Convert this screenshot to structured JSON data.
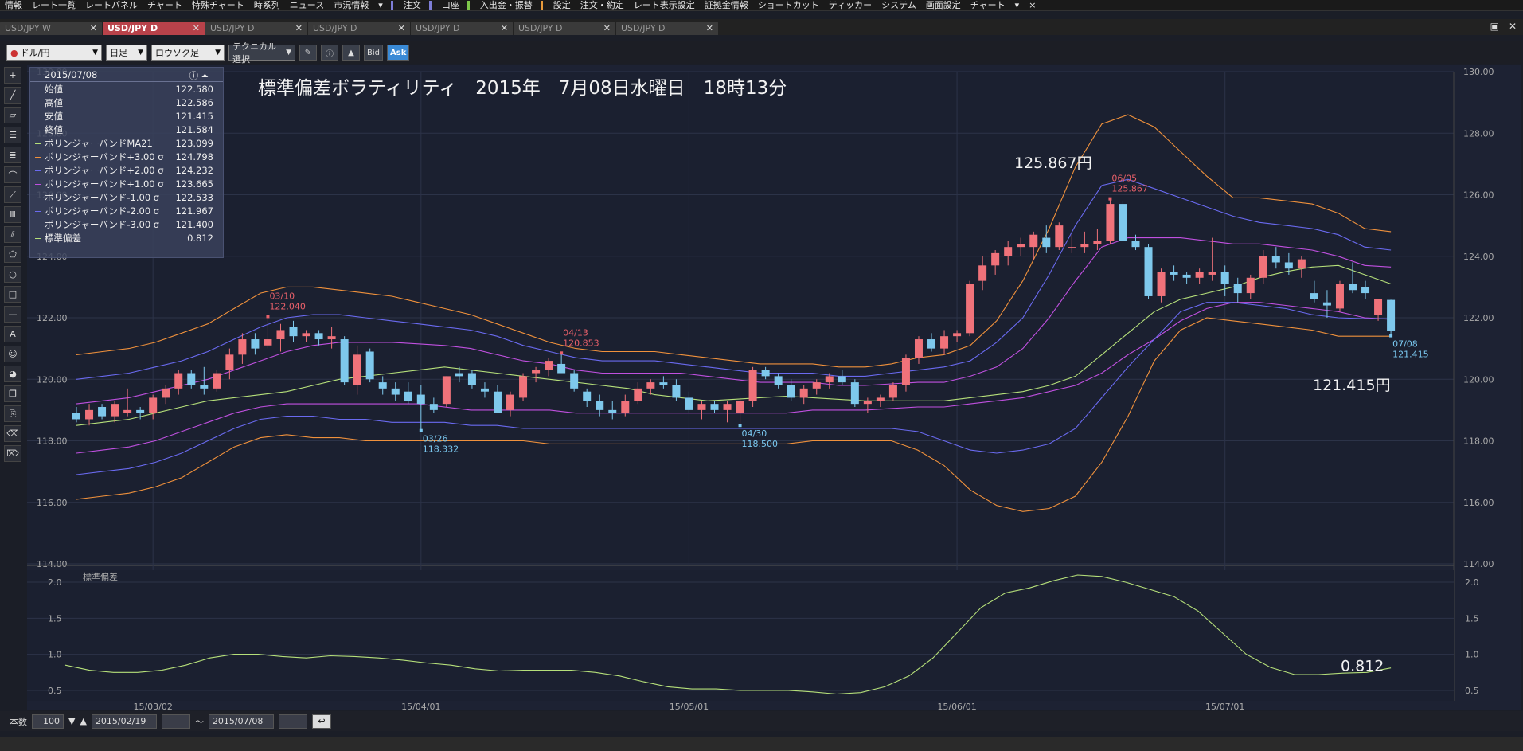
{
  "menubar": {
    "items": [
      "情報",
      "レート一覧",
      "レートパネル",
      "チャート",
      "特殊チャート",
      "時系列",
      "ニュース",
      "市況情報",
      "▾",
      "注文",
      "口座",
      "入出金・振替",
      "設定",
      "注文・約定",
      "レート表示設定",
      "証拠金情報",
      "ショートカット",
      "ティッカー",
      "システム",
      "画面設定",
      "チャート",
      "▾",
      "×"
    ]
  },
  "tabs": [
    {
      "label": "USD/JPY W",
      "active": false
    },
    {
      "label": "USD/JPY D",
      "active": true
    },
    {
      "label": "USD/JPY D",
      "active": false
    },
    {
      "label": "USD/JPY D",
      "active": false
    },
    {
      "label": "USD/JPY D",
      "active": false
    },
    {
      "label": "USD/JPY D",
      "active": false
    },
    {
      "label": "USD/JPY D",
      "active": false
    }
  ],
  "toolbar": {
    "pair": "ドル/円",
    "timeframe": "日足",
    "chart_type": "ロウソク足",
    "technical": "テクニカル選択",
    "bid": "Bid",
    "ask": "Ask"
  },
  "info": {
    "date": "2015/07/08",
    "rows": [
      {
        "label": "始値",
        "value": "122.580",
        "color": ""
      },
      {
        "label": "高値",
        "value": "122.586",
        "color": ""
      },
      {
        "label": "安値",
        "value": "121.415",
        "color": ""
      },
      {
        "label": "終値",
        "value": "121.584",
        "color": ""
      },
      {
        "label": "ボリンジャーバンドMA21",
        "value": "123.099",
        "color": "#b6e07a"
      },
      {
        "label": "ボリンジャーバンド+3.00 σ",
        "value": "124.798",
        "color": "#f0913c"
      },
      {
        "label": "ボリンジャーバンド+2.00 σ",
        "value": "124.232",
        "color": "#6a6af0"
      },
      {
        "label": "ボリンジャーバンド+1.00 σ",
        "value": "123.665",
        "color": "#c050e0"
      },
      {
        "label": "ボリンジャーバンド-1.00 σ",
        "value": "122.533",
        "color": "#c050e0"
      },
      {
        "label": "ボリンジャーバンド-2.00 σ",
        "value": "121.967",
        "color": "#6a6af0"
      },
      {
        "label": "ボリンジャーバンド-3.00 σ",
        "value": "121.400",
        "color": "#f0913c"
      },
      {
        "label": "標準偏差",
        "value": "0.812",
        "color": "#b6e07a"
      }
    ]
  },
  "chart_data": {
    "type": "candlestick",
    "title": "標準偏差ボラティリティ　2015年　7月08日水曜日　18時13分",
    "ylim": [
      114,
      130
    ],
    "yticks": [
      "130.00",
      "128.00",
      "126.00",
      "124.00",
      "122.00",
      "120.00",
      "118.00",
      "116.00",
      "114.00"
    ],
    "xticks": [
      "15/03/02",
      "15/04/01",
      "15/05/01",
      "15/06/01",
      "15/07/01"
    ],
    "candles": [
      [
        118.9,
        119.1,
        118.6,
        118.7
      ],
      [
        118.7,
        119.2,
        118.5,
        119.0
      ],
      [
        119.1,
        119.2,
        118.7,
        118.8
      ],
      [
        118.8,
        119.3,
        118.6,
        119.2
      ],
      [
        118.9,
        119.7,
        118.8,
        119.0
      ],
      [
        119.0,
        119.1,
        118.7,
        118.9
      ],
      [
        118.9,
        119.5,
        118.7,
        119.4
      ],
      [
        119.4,
        119.8,
        119.2,
        119.7
      ],
      [
        119.7,
        120.3,
        119.5,
        120.2
      ],
      [
        120.2,
        120.3,
        119.7,
        119.8
      ],
      [
        119.8,
        120.4,
        119.5,
        119.7
      ],
      [
        119.7,
        120.3,
        119.6,
        120.2
      ],
      [
        120.3,
        121.0,
        120.0,
        120.8
      ],
      [
        120.8,
        121.5,
        120.5,
        121.3
      ],
      [
        121.3,
        121.5,
        120.8,
        121.0
      ],
      [
        121.1,
        122.04,
        121.0,
        121.3
      ],
      [
        121.3,
        121.8,
        120.9,
        121.6
      ],
      [
        121.7,
        121.9,
        121.2,
        121.4
      ],
      [
        121.4,
        121.6,
        121.2,
        121.5
      ],
      [
        121.5,
        121.6,
        121.1,
        121.3
      ],
      [
        121.3,
        121.7,
        121.0,
        121.4
      ],
      [
        121.3,
        121.4,
        119.8,
        119.9
      ],
      [
        119.8,
        121.1,
        119.5,
        120.8
      ],
      [
        120.9,
        121.0,
        119.9,
        120.0
      ],
      [
        119.9,
        120.1,
        119.5,
        119.7
      ],
      [
        119.7,
        119.9,
        119.3,
        119.5
      ],
      [
        119.6,
        119.9,
        119.2,
        119.3
      ],
      [
        119.5,
        119.8,
        118.332,
        119.2
      ],
      [
        119.2,
        119.4,
        118.9,
        119.0
      ],
      [
        119.2,
        120.1,
        119.1,
        120.1
      ],
      [
        120.2,
        120.4,
        119.9,
        120.1
      ],
      [
        120.2,
        120.3,
        119.7,
        119.8
      ],
      [
        119.7,
        119.9,
        119.4,
        119.6
      ],
      [
        119.6,
        119.8,
        119.0,
        118.9
      ],
      [
        119.0,
        119.6,
        118.8,
        119.5
      ],
      [
        119.4,
        120.2,
        119.3,
        120.1
      ],
      [
        120.2,
        120.4,
        119.9,
        120.3
      ],
      [
        120.3,
        120.7,
        120.1,
        120.6
      ],
      [
        120.5,
        120.853,
        120.2,
        120.2
      ],
      [
        120.2,
        120.3,
        119.6,
        119.7
      ],
      [
        119.6,
        119.7,
        119.1,
        119.3
      ],
      [
        119.3,
        119.5,
        118.8,
        119.0
      ],
      [
        119.0,
        119.3,
        118.7,
        118.9
      ],
      [
        118.9,
        119.5,
        118.8,
        119.3
      ],
      [
        119.3,
        119.9,
        119.2,
        119.7
      ],
      [
        119.7,
        120.0,
        119.5,
        119.9
      ],
      [
        119.9,
        120.1,
        119.7,
        119.8
      ],
      [
        119.8,
        120.0,
        119.3,
        119.4
      ],
      [
        119.4,
        119.6,
        118.9,
        119.0
      ],
      [
        119.0,
        119.3,
        118.7,
        119.2
      ],
      [
        119.2,
        119.3,
        118.9,
        119.0
      ],
      [
        119.0,
        119.3,
        118.6,
        119.2
      ],
      [
        118.9,
        119.4,
        118.5,
        119.3
      ],
      [
        119.3,
        120.4,
        119.1,
        120.3
      ],
      [
        120.3,
        120.4,
        120.0,
        120.1
      ],
      [
        120.1,
        120.2,
        119.7,
        119.8
      ],
      [
        119.8,
        120.0,
        119.3,
        119.4
      ],
      [
        119.4,
        119.8,
        119.2,
        119.7
      ],
      [
        119.7,
        120.0,
        119.5,
        119.9
      ],
      [
        119.9,
        120.2,
        119.7,
        120.1
      ],
      [
        120.1,
        120.3,
        119.8,
        119.9
      ],
      [
        119.9,
        120.0,
        119.1,
        119.2
      ],
      [
        119.2,
        119.4,
        118.9,
        119.3
      ],
      [
        119.3,
        119.5,
        119.1,
        119.4
      ],
      [
        119.4,
        119.9,
        119.3,
        119.8
      ],
      [
        119.8,
        120.8,
        119.6,
        120.7
      ],
      [
        120.7,
        121.4,
        120.5,
        121.3
      ],
      [
        121.3,
        121.5,
        120.9,
        121.0
      ],
      [
        121.0,
        121.6,
        120.8,
        121.4
      ],
      [
        121.4,
        121.6,
        121.2,
        121.5
      ],
      [
        121.5,
        123.2,
        121.4,
        123.1
      ],
      [
        123.2,
        124.0,
        122.9,
        123.7
      ],
      [
        123.7,
        124.2,
        123.4,
        124.1
      ],
      [
        124.0,
        124.5,
        123.7,
        124.3
      ],
      [
        124.3,
        124.6,
        124.0,
        124.4
      ],
      [
        124.3,
        124.8,
        123.9,
        124.7
      ],
      [
        124.6,
        125.0,
        124.1,
        124.3
      ],
      [
        124.3,
        125.1,
        124.2,
        125.0
      ],
      [
        124.3,
        124.7,
        124.1,
        124.3
      ],
      [
        124.3,
        124.8,
        124.1,
        124.4
      ],
      [
        124.4,
        124.9,
        124.2,
        124.5
      ],
      [
        124.5,
        125.867,
        124.4,
        125.7
      ],
      [
        125.7,
        125.8,
        124.5,
        124.5
      ],
      [
        124.5,
        124.7,
        124.2,
        124.3
      ],
      [
        124.3,
        124.4,
        122.6,
        122.7
      ],
      [
        122.7,
        123.6,
        122.5,
        123.5
      ],
      [
        123.5,
        123.7,
        123.2,
        123.4
      ],
      [
        123.4,
        123.5,
        123.1,
        123.3
      ],
      [
        123.3,
        123.6,
        123.1,
        123.5
      ],
      [
        123.4,
        124.6,
        123.2,
        123.5
      ],
      [
        123.5,
        123.7,
        122.7,
        123.1
      ],
      [
        123.1,
        123.3,
        122.5,
        122.8
      ],
      [
        122.8,
        123.4,
        122.6,
        123.3
      ],
      [
        123.3,
        124.2,
        123.1,
        124.0
      ],
      [
        124.0,
        124.3,
        123.6,
        123.8
      ],
      [
        123.8,
        124.1,
        123.4,
        123.6
      ],
      [
        123.6,
        124.0,
        123.3,
        123.9
      ],
      [
        122.8,
        123.2,
        122.5,
        122.6
      ],
      [
        122.5,
        122.9,
        122.0,
        122.4
      ],
      [
        122.3,
        123.2,
        122.2,
        123.1
      ],
      [
        123.1,
        123.8,
        122.8,
        122.9
      ],
      [
        123.0,
        123.2,
        122.6,
        122.8
      ],
      [
        122.1,
        122.6,
        121.9,
        122.6
      ],
      [
        122.58,
        122.586,
        121.415,
        121.584
      ]
    ],
    "annotations": [
      {
        "idx": 15,
        "date": "03/10",
        "price": "122.040",
        "side": "high",
        "color": "#e8606a"
      },
      {
        "idx": 27,
        "date": "03/26",
        "price": "118.332",
        "side": "low",
        "color": "#7ac8f0"
      },
      {
        "idx": 38,
        "date": "04/13",
        "price": "120.853",
        "side": "high",
        "color": "#e8606a"
      },
      {
        "idx": 52,
        "date": "04/30",
        "price": "118.500",
        "side": "low",
        "color": "#7ac8f0"
      },
      {
        "idx": 81,
        "date": "06/05",
        "price": "125.867",
        "side": "high",
        "color": "#e8606a"
      },
      {
        "idx": 103,
        "date": "07/08",
        "price": "121.415",
        "side": "low",
        "color": "#7ac8f0"
      }
    ],
    "big_labels": {
      "high": "125.867円",
      "low": "121.415円",
      "stddev": "0.812"
    },
    "bands": {
      "ma21": [
        118.5,
        118.6,
        118.7,
        118.9,
        119.1,
        119.3,
        119.4,
        119.5,
        119.6,
        119.8,
        120.0,
        120.1,
        120.2,
        120.3,
        120.4,
        120.3,
        120.2,
        120.1,
        120.0,
        119.9,
        119.8,
        119.7,
        119.5,
        119.4,
        119.3,
        119.35,
        119.4,
        119.45,
        119.4,
        119.35,
        119.3,
        119.3,
        119.3,
        119.3,
        119.4,
        119.5,
        119.6,
        119.8,
        120.1,
        120.8,
        121.5,
        122.2,
        122.6,
        122.8,
        123.0,
        123.3,
        123.5,
        123.65,
        123.7,
        123.4,
        123.1
      ],
      "p1": [
        119.2,
        119.3,
        119.4,
        119.6,
        119.8,
        120.0,
        120.3,
        120.6,
        120.9,
        121.1,
        121.2,
        121.2,
        121.2,
        121.15,
        121.1,
        121.0,
        120.8,
        120.6,
        120.5,
        120.3,
        120.2,
        120.2,
        120.2,
        120.2,
        120.1,
        120.0,
        119.9,
        119.9,
        119.9,
        119.8,
        119.8,
        119.85,
        119.9,
        119.9,
        120.1,
        120.4,
        121.0,
        122.0,
        123.2,
        124.3,
        124.6,
        124.6,
        124.6,
        124.5,
        124.4,
        124.4,
        124.3,
        124.2,
        124.0,
        123.7,
        123.65
      ],
      "p2": [
        120.0,
        120.1,
        120.2,
        120.4,
        120.6,
        120.9,
        121.3,
        121.7,
        122.0,
        122.1,
        122.1,
        122.0,
        121.9,
        121.8,
        121.7,
        121.6,
        121.4,
        121.1,
        120.9,
        120.7,
        120.6,
        120.6,
        120.6,
        120.5,
        120.4,
        120.3,
        120.2,
        120.2,
        120.2,
        120.1,
        120.1,
        120.2,
        120.3,
        120.4,
        120.6,
        121.2,
        122.0,
        123.4,
        125.0,
        126.3,
        126.5,
        126.2,
        125.9,
        125.6,
        125.3,
        125.1,
        125.0,
        124.9,
        124.7,
        124.3,
        124.2
      ],
      "p3": [
        120.8,
        120.9,
        121.0,
        121.2,
        121.5,
        121.8,
        122.3,
        122.8,
        123.0,
        123.0,
        122.9,
        122.8,
        122.7,
        122.5,
        122.3,
        122.1,
        121.8,
        121.5,
        121.2,
        121.0,
        120.9,
        120.9,
        120.9,
        120.8,
        120.7,
        120.6,
        120.5,
        120.5,
        120.5,
        120.4,
        120.4,
        120.5,
        120.7,
        120.8,
        121.1,
        121.9,
        123.2,
        124.9,
        126.9,
        128.3,
        128.6,
        128.2,
        127.4,
        126.6,
        125.9,
        125.9,
        125.8,
        125.7,
        125.4,
        124.9,
        124.8
      ],
      "m1": [
        117.6,
        117.7,
        117.8,
        118.0,
        118.3,
        118.6,
        118.9,
        119.1,
        119.2,
        119.2,
        119.2,
        119.2,
        119.2,
        119.2,
        119.1,
        119.0,
        119.0,
        119.0,
        119.0,
        118.9,
        118.9,
        118.9,
        118.9,
        118.9,
        118.9,
        118.9,
        118.9,
        118.9,
        119.0,
        119.0,
        119.0,
        119.05,
        119.1,
        119.1,
        119.2,
        119.3,
        119.4,
        119.6,
        119.8,
        120.2,
        120.8,
        121.3,
        121.9,
        122.3,
        122.5,
        122.5,
        122.4,
        122.3,
        122.2,
        122.0,
        121.95
      ],
      "m2": [
        116.9,
        117.0,
        117.1,
        117.3,
        117.6,
        118.0,
        118.4,
        118.7,
        118.8,
        118.8,
        118.7,
        118.7,
        118.6,
        118.6,
        118.6,
        118.5,
        118.5,
        118.4,
        118.4,
        118.4,
        118.4,
        118.4,
        118.4,
        118.4,
        118.4,
        118.4,
        118.4,
        118.4,
        118.4,
        118.4,
        118.4,
        118.4,
        118.3,
        118.0,
        117.7,
        117.6,
        117.7,
        117.9,
        118.4,
        119.4,
        120.4,
        121.3,
        122.2,
        122.5,
        122.5,
        122.4,
        122.3,
        122.1,
        122.0,
        121.97,
        121.97
      ],
      "m3": [
        116.1,
        116.2,
        116.3,
        116.5,
        116.8,
        117.3,
        117.8,
        118.1,
        118.2,
        118.1,
        118.1,
        118.0,
        118.0,
        118.0,
        118.0,
        118.0,
        118.0,
        118.0,
        117.9,
        117.9,
        117.9,
        117.9,
        117.9,
        117.9,
        117.9,
        117.9,
        117.9,
        117.9,
        118.0,
        118.0,
        118.0,
        118.0,
        117.7,
        117.2,
        116.4,
        115.9,
        115.7,
        115.8,
        116.2,
        117.3,
        118.8,
        120.6,
        121.6,
        122.0,
        121.9,
        121.8,
        121.7,
        121.6,
        121.4,
        121.4,
        121.4
      ]
    },
    "sub": {
      "label": "標準偏差",
      "ylim": [
        0.4,
        2.1
      ],
      "yticks": [
        "2.0",
        "1.5",
        "1.0",
        "0.5"
      ],
      "values": [
        0.85,
        0.78,
        0.75,
        0.75,
        0.78,
        0.85,
        0.95,
        1.0,
        1.0,
        0.97,
        0.95,
        0.98,
        0.97,
        0.95,
        0.92,
        0.88,
        0.85,
        0.8,
        0.77,
        0.78,
        0.78,
        0.78,
        0.75,
        0.7,
        0.62,
        0.55,
        0.52,
        0.52,
        0.5,
        0.5,
        0.5,
        0.48,
        0.45,
        0.47,
        0.55,
        0.7,
        0.95,
        1.3,
        1.65,
        1.85,
        1.92,
        2.02,
        2.1,
        2.08,
        2.0,
        1.9,
        1.8,
        1.6,
        1.3,
        1.0,
        0.82,
        0.72,
        0.72,
        0.74,
        0.75,
        0.812
      ]
    }
  },
  "bottom": {
    "count_label": "本数",
    "count": "100",
    "from": "2015/02/19",
    "tilde": "～",
    "to": "2015/07/08"
  }
}
